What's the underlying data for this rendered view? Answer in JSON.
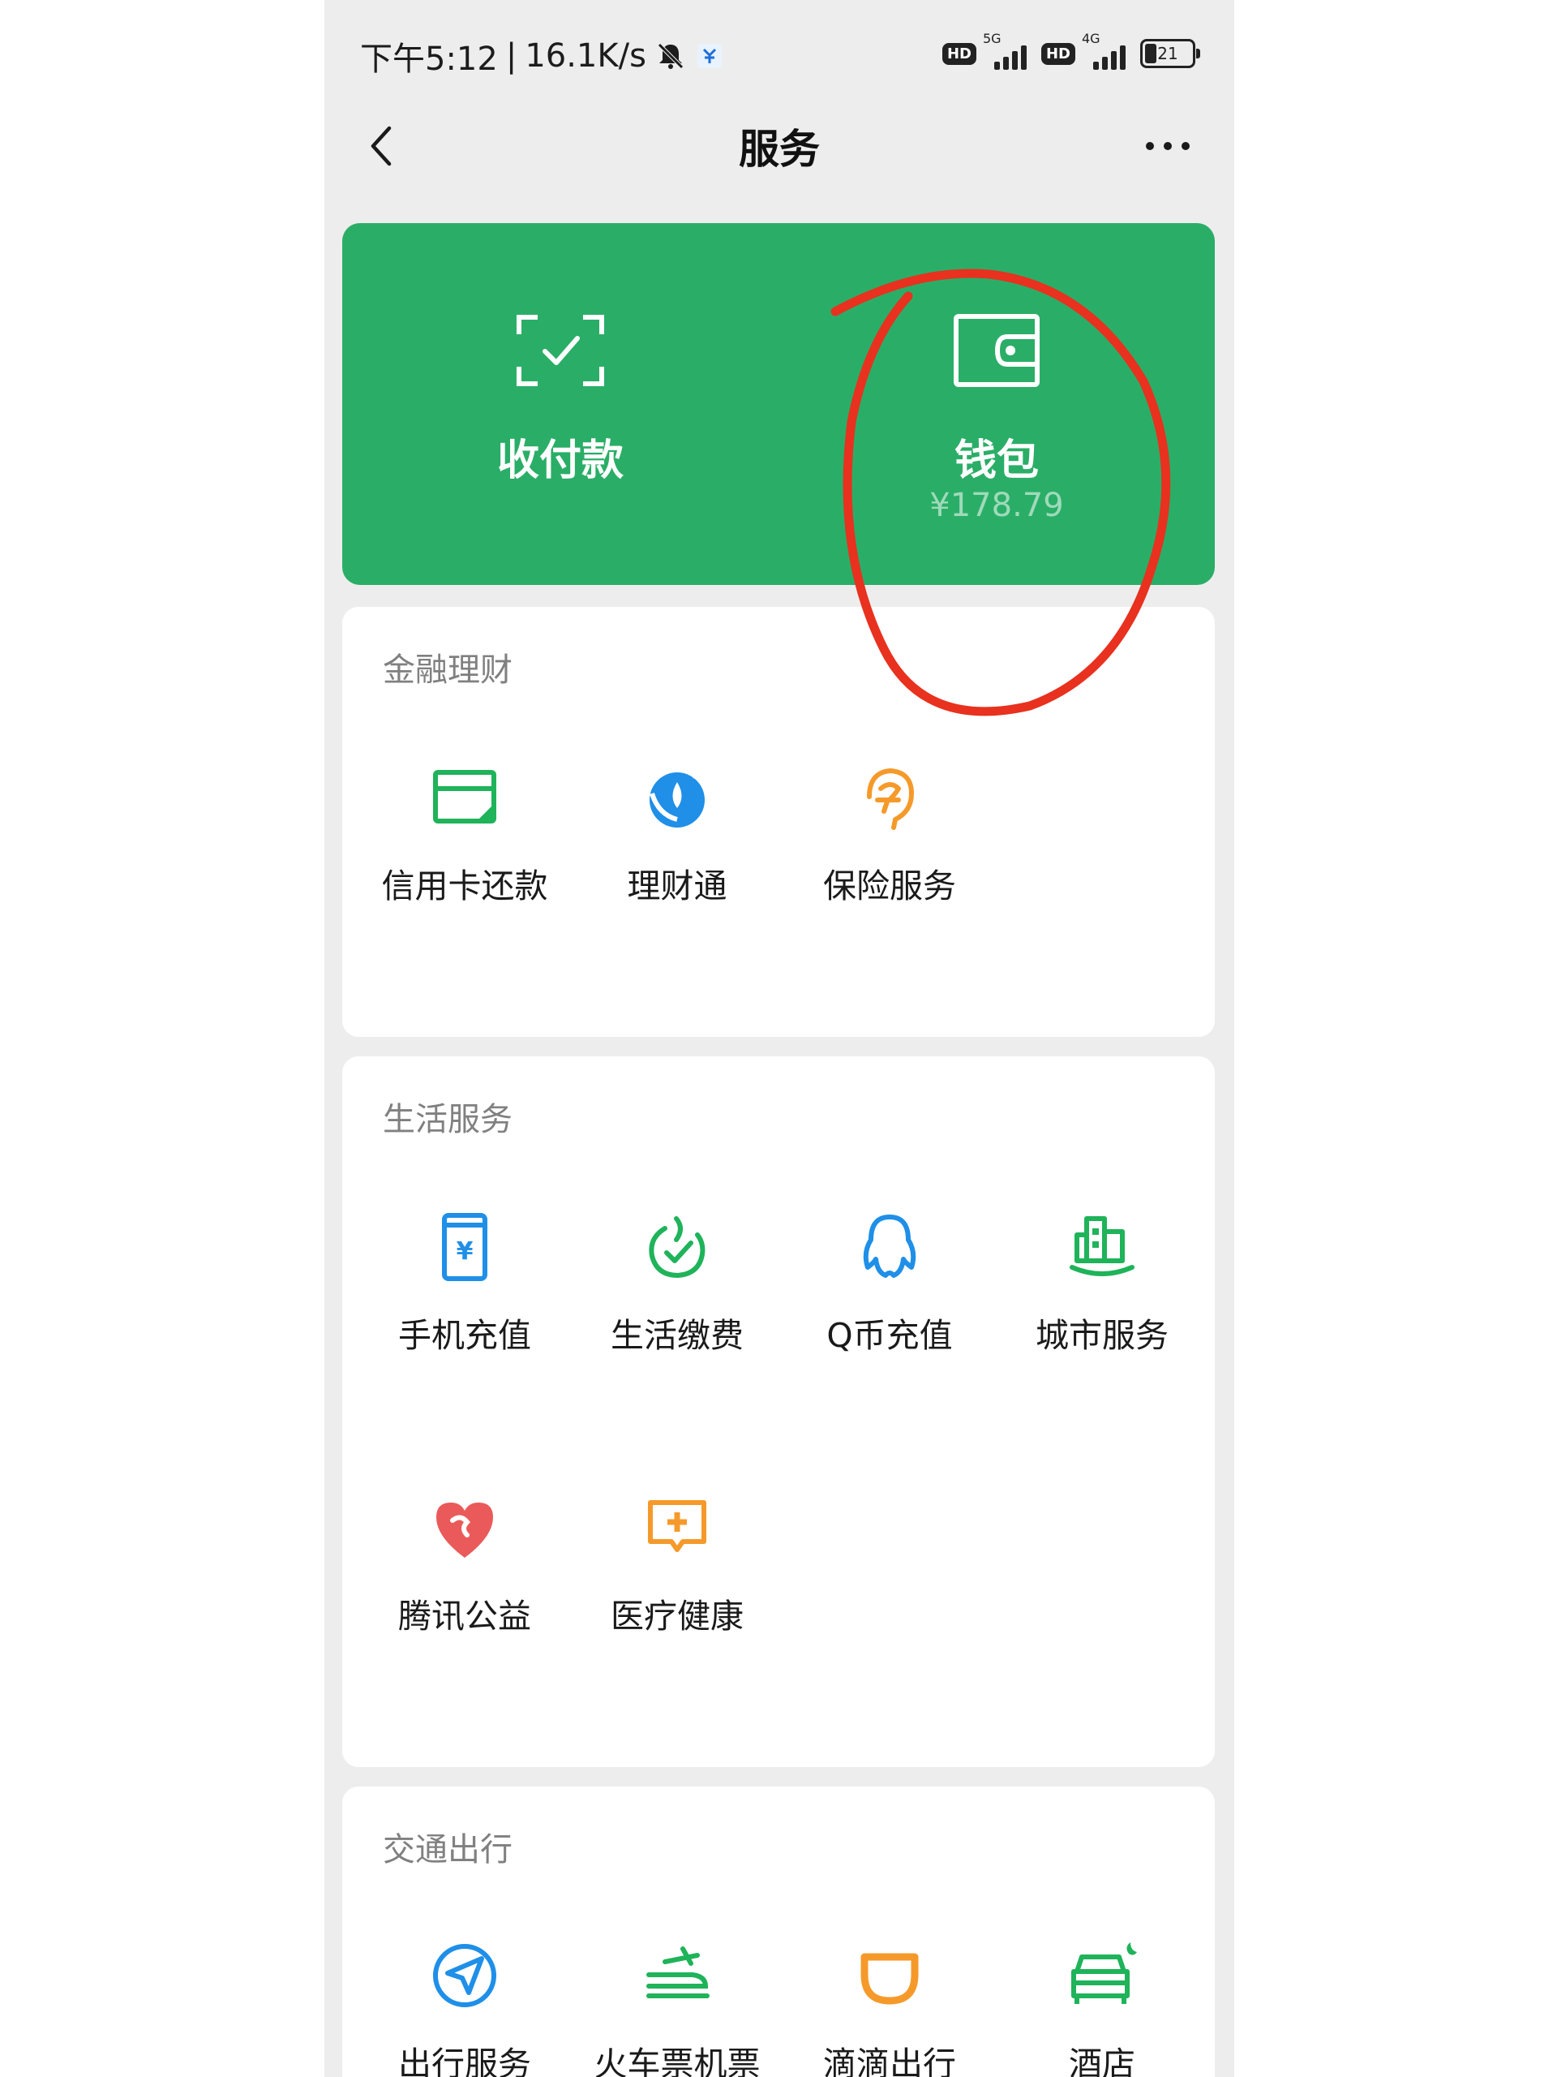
{
  "status": {
    "time": "下午5:12",
    "separator": "|",
    "speed": "16.1K/s",
    "signal1": "5G",
    "signal2": "4G",
    "battery": "21",
    "hd": "HD"
  },
  "nav": {
    "title": "服务"
  },
  "wallet_card": {
    "pay_label": "收付款",
    "wallet_label": "钱包",
    "wallet_balance": "¥178.79"
  },
  "sections": {
    "finance": {
      "title": "金融理财",
      "items": [
        "信用卡还款",
        "理财通",
        "保险服务"
      ]
    },
    "life": {
      "title": "生活服务",
      "items": [
        "手机充值",
        "生活缴费",
        "Q币充值",
        "城市服务",
        "腾讯公益",
        "医疗健康"
      ]
    },
    "transport": {
      "title": "交通出行",
      "items": [
        "出行服务",
        "火车票机票",
        "滴滴出行",
        "酒店"
      ]
    }
  },
  "colors": {
    "card_green": "#2aae67",
    "icon_green": "#1fb35a",
    "icon_blue": "#1f8fe8",
    "icon_orange": "#f59a2a",
    "icon_red": "#ea5a5a",
    "annotation_red": "#e8311f"
  }
}
